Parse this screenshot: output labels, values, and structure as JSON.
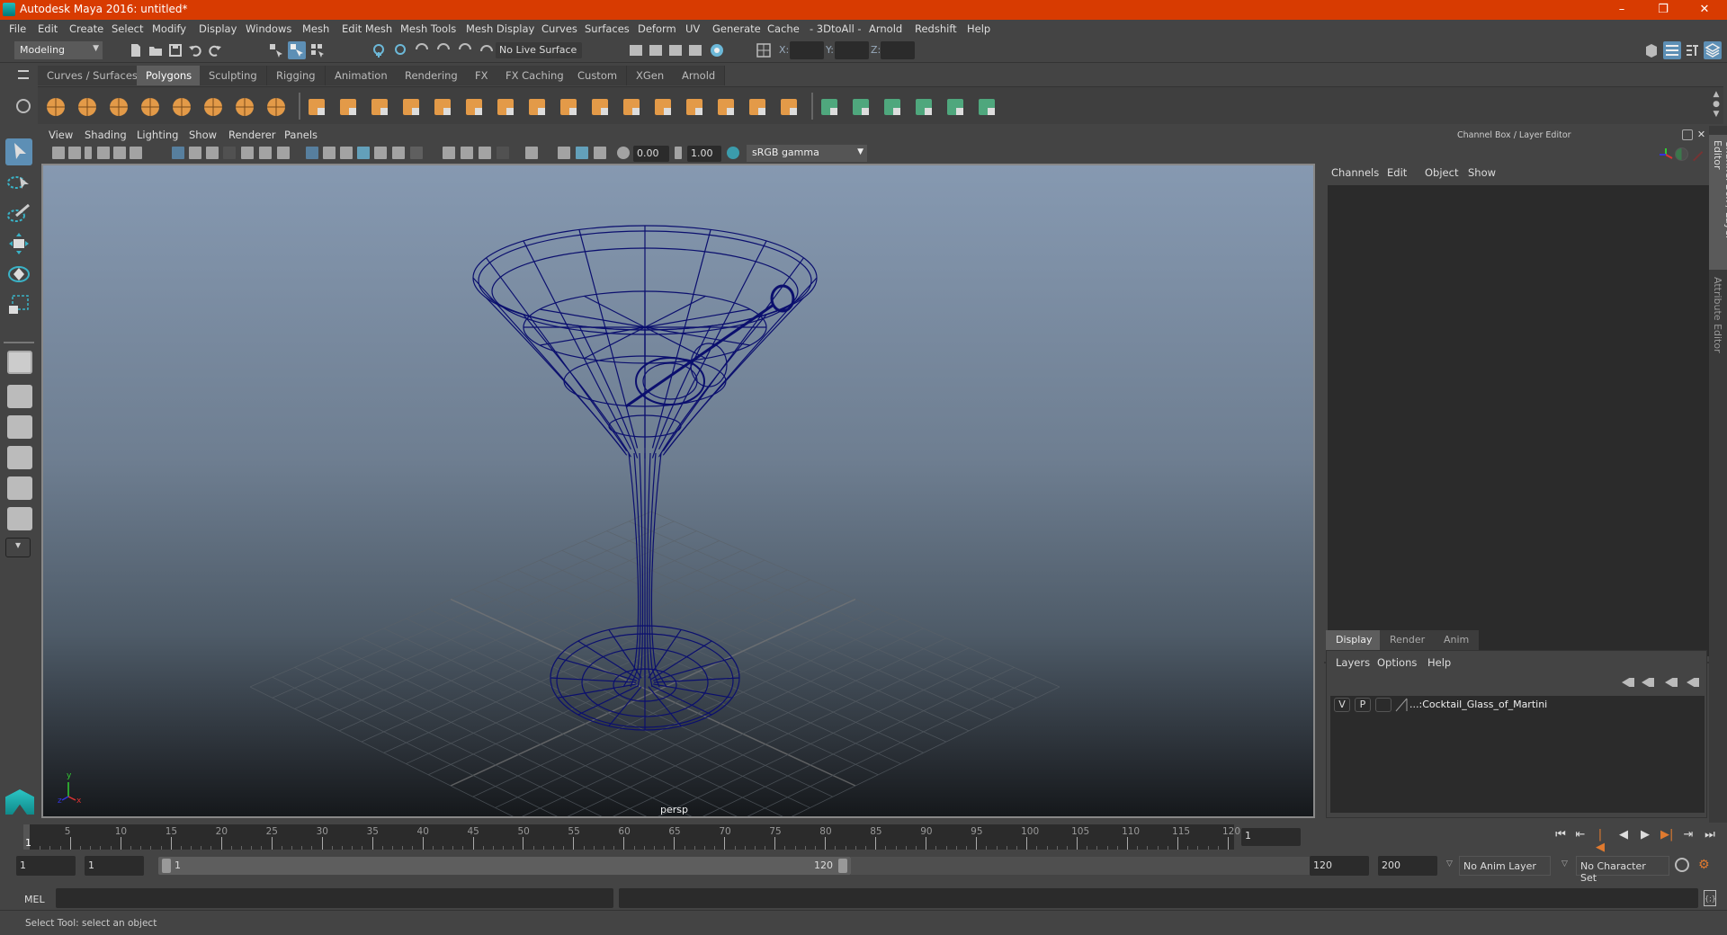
{
  "window": {
    "title": "Autodesk Maya 2016: untitled*",
    "controls": {
      "minimize": "–",
      "restore": "❐",
      "close": "✕"
    }
  },
  "menubar": {
    "items": [
      "File",
      "Edit",
      "Create",
      "Select",
      "Modify",
      "Display",
      "Windows",
      "Mesh",
      "Edit Mesh",
      "Mesh Tools",
      "Mesh Display",
      "Curves",
      "Surfaces",
      "Deform",
      "UV",
      "Generate",
      "Cache",
      "- 3DtoAll -",
      "Arnold",
      "Redshift",
      "Help"
    ]
  },
  "statusline": {
    "menuset": "Modeling",
    "live_surface": "No Live Surface",
    "x_label": "X:",
    "y_label": "Y:",
    "z_label": "Z:",
    "x_value": "",
    "y_value": "",
    "z_value": ""
  },
  "shelf": {
    "tabs": [
      "Curves / Surfaces",
      "Polygons",
      "Sculpting",
      "Rigging",
      "Animation",
      "Rendering",
      "FX",
      "FX Caching",
      "Custom",
      "XGen",
      "Arnold"
    ],
    "active_tab": "Polygons",
    "icons": [
      "poly-sphere",
      "poly-cube",
      "poly-cylinder",
      "poly-cone",
      "poly-plane",
      "poly-torus",
      "poly-pyramid",
      "poly-pipe",
      "combine",
      "separate",
      "mirror",
      "smooth",
      "extract",
      "boolean",
      "bevel",
      "bridge",
      "insert-edge-loop",
      "multi-cut",
      "extrude",
      "target-weld",
      "fill-hole",
      "make-hole",
      "quadrangulate",
      "planar-uv",
      "cylindrical-uv",
      "spherical-uv",
      "automatic-uv",
      "unfold-uv",
      "uv-editor",
      "layout-uv"
    ]
  },
  "viewport": {
    "menus": [
      "View",
      "Shading",
      "Lighting",
      "Show",
      "Renderer",
      "Panels"
    ],
    "exposure": "0.00",
    "gamma": "1.00",
    "color_space": "sRGB gamma",
    "camera_label": "persp",
    "axis": {
      "x": "x",
      "y": "y",
      "z": "z"
    },
    "wire_color": "#0b0f6e"
  },
  "channelbox": {
    "title": "Channel Box / Layer Editor",
    "menus": [
      "Channels",
      "Edit",
      "Object",
      "Show"
    ]
  },
  "layer_editor": {
    "tabs": [
      "Display",
      "Render",
      "Anim"
    ],
    "active_tab": "Display",
    "menus": [
      "Layers",
      "Options",
      "Help"
    ],
    "layers": [
      {
        "visible": "V",
        "playback": "P",
        "name": "...:Cocktail_Glass_of_Martini"
      }
    ]
  },
  "side_tabs": [
    "Channel Box / Layer Editor",
    "Attribute Editor"
  ],
  "timeline": {
    "ticks": [
      5,
      10,
      15,
      20,
      25,
      30,
      35,
      40,
      45,
      50,
      55,
      60,
      65,
      70,
      75,
      80,
      85,
      90,
      95,
      100,
      105,
      110,
      115,
      120
    ],
    "current_frame": "1",
    "current_frame_field": "1"
  },
  "range": {
    "start": "1",
    "playback_start": "1",
    "slider_start": "1",
    "slider_end": "120",
    "playback_end": "120",
    "end": "200",
    "anim_layer": "No Anim Layer",
    "character_set": "No Character Set"
  },
  "command_line": {
    "lang": "MEL",
    "input": "",
    "output": ""
  },
  "help_line": {
    "text": "Select Tool: select an object"
  }
}
